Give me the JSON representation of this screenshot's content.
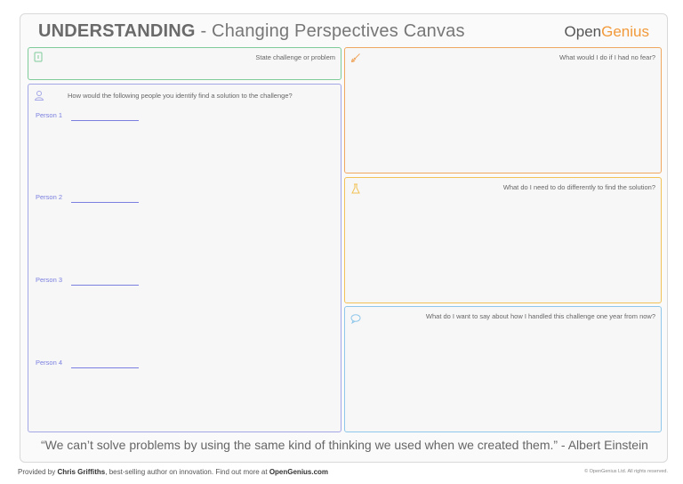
{
  "header": {
    "title_strong": "UNDERSTANDING",
    "title_rest": " - Changing Perspectives Canvas",
    "logo_open": "Open",
    "logo_genius": "Genius"
  },
  "boxes": {
    "state": {
      "label": "State challenge or problem",
      "icon": "document-icon",
      "color": "#7fcc9a"
    },
    "people": {
      "label": "How would the following people you identify find a solution to the challenge?",
      "icon": "person-icon",
      "color": "#a4a7e6"
    },
    "fear": {
      "label": "What would I do if I had no fear?",
      "icon": "rocket-icon",
      "color": "#f0a860"
    },
    "diff": {
      "label": "What do I need to do differently to find the solution?",
      "icon": "flask-icon",
      "color": "#f2c257"
    },
    "year": {
      "label": "What do I want to say about how I handled this challenge one year from now?",
      "icon": "speech-bubble-icon",
      "color": "#8fc7ea"
    }
  },
  "persons": [
    "Person 1",
    "Person 2",
    "Person 3",
    "Person 4"
  ],
  "quote": "“We can’t solve problems by using the same kind of thinking we used when we created them.” - Albert Einstein",
  "footer": {
    "provided_prefix": "Provided by ",
    "author": "Chris Griffiths",
    "middle": ", best-selling author on innovation. Find out more at ",
    "site": "OpenGenius.com",
    "copyright": "© OpenGenius Ltd. All rights reserved."
  }
}
